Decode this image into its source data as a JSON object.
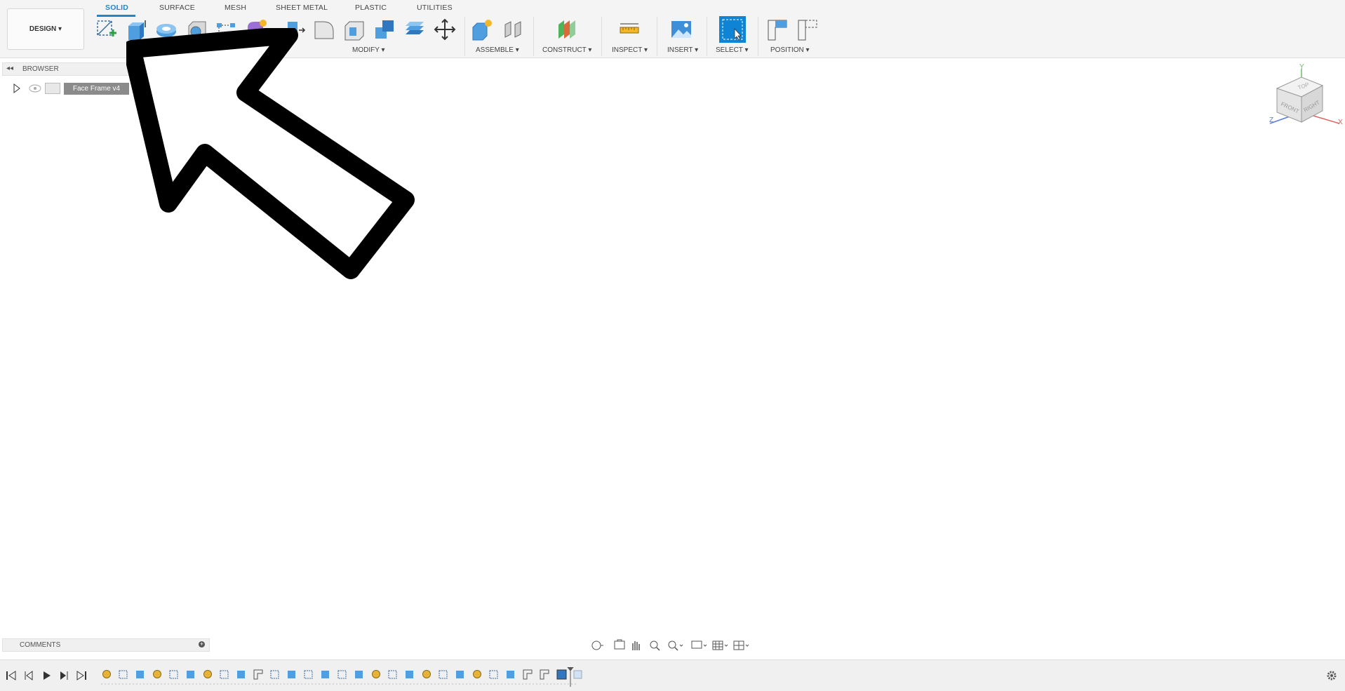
{
  "workspace": {
    "label": "DESIGN ▾"
  },
  "tabs": [
    {
      "label": "SOLID",
      "active": true
    },
    {
      "label": "SURFACE"
    },
    {
      "label": "MESH"
    },
    {
      "label": "SHEET METAL"
    },
    {
      "label": "PLASTIC"
    },
    {
      "label": "UTILITIES"
    }
  ],
  "groups": {
    "modify": "MODIFY ▾",
    "assemble": "ASSEMBLE ▾",
    "construct": "CONSTRUCT ▾",
    "inspect": "INSPECT ▾",
    "insert": "INSERT ▾",
    "select": "SELECT ▾",
    "position": "POSITION ▾"
  },
  "browser": {
    "title": "BROWSER",
    "component": "Face Frame v4"
  },
  "comments": {
    "title": "COMMENTS"
  },
  "viewcube": {
    "top": "TOP",
    "front": "FRONT",
    "right": "RIGHT",
    "axis_x": "X",
    "axis_y": "Y",
    "axis_z": "Z"
  },
  "colors": {
    "accent": "#1a87d0",
    "select_tool_bg": "#0f84d4"
  }
}
